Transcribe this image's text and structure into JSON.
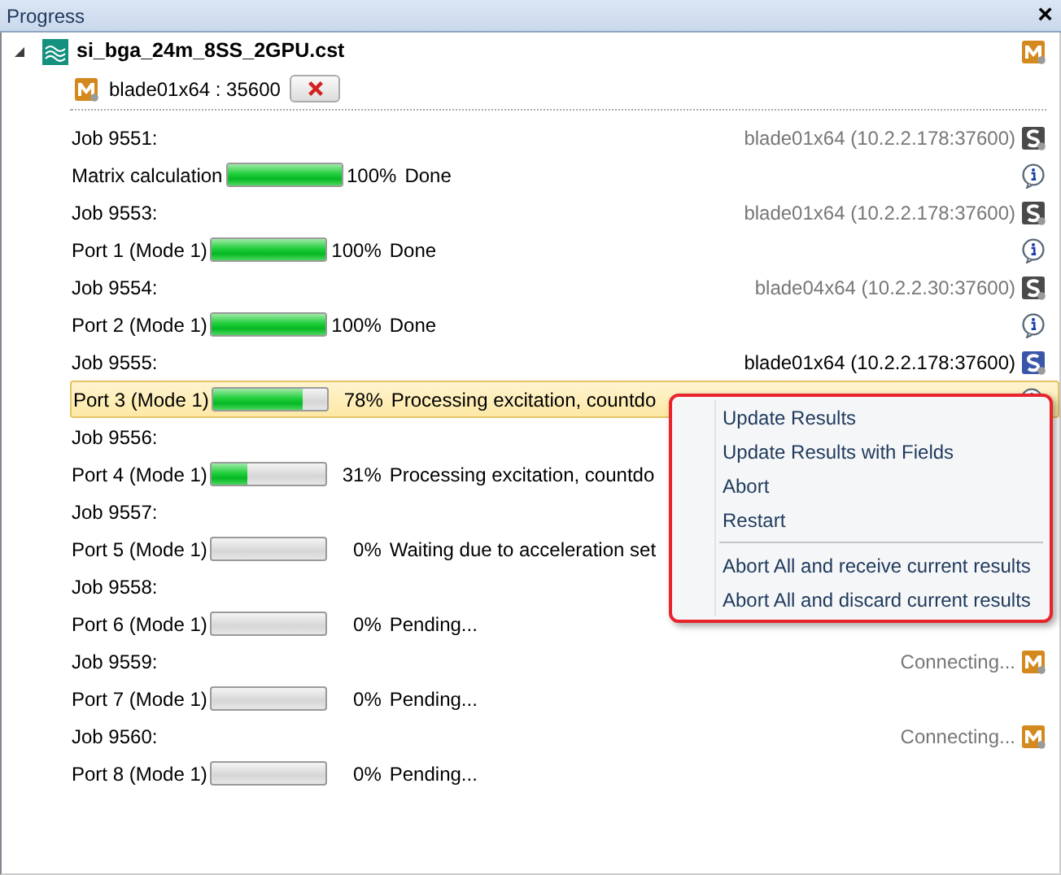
{
  "panel": {
    "title": "Progress",
    "close": "×"
  },
  "project": {
    "name": "si_bga_24m_8SS_2GPU.cst",
    "expanded": true
  },
  "server": {
    "label": "blade01x64 : 35600"
  },
  "jobs": [
    {
      "label": "Job 9551:",
      "host": "blade01x64 (10.2.2.178:37600)",
      "kind": "solver",
      "active": false,
      "task": {
        "label": "Matrix calculation",
        "level": 1,
        "percent": "100%",
        "status": "Done",
        "info": true,
        "selected": false
      }
    },
    {
      "label": "Job 9553:",
      "host": "blade01x64 (10.2.2.178:37600)",
      "kind": "solver",
      "active": false,
      "task": {
        "label": "Port 1 (Mode 1)",
        "level": 1,
        "percent": "100%",
        "status": "Done",
        "info": true,
        "selected": false
      }
    },
    {
      "label": "Job 9554:",
      "host": "blade04x64 (10.2.2.30:37600)",
      "kind": "solver",
      "active": false,
      "task": {
        "label": "Port 2 (Mode 1)",
        "level": 1,
        "percent": "100%",
        "status": "Done",
        "info": true,
        "selected": false
      }
    },
    {
      "label": "Job 9555:",
      "host": "blade01x64 (10.2.2.178:37600)",
      "kind": "solver",
      "active": true,
      "task": {
        "label": "Port 3 (Mode 1)",
        "level": 0.78,
        "percent": "78%",
        "status": "Processing excitation, countdo",
        "info": true,
        "selected": true
      }
    },
    {
      "label": "Job 9556:",
      "task": {
        "label": "Port 4 (Mode 1)",
        "level": 0.31,
        "percent": "31%",
        "status": "Processing excitation, countdo",
        "info": false,
        "selected": false
      }
    },
    {
      "label": "Job 9557:",
      "task": {
        "label": "Port 5 (Mode 1)",
        "level": 0,
        "percent": "0%",
        "status": "Waiting due to acceleration set",
        "info": false,
        "selected": false
      }
    },
    {
      "label": "Job 9558:",
      "task": {
        "label": "Port 6 (Mode 1)",
        "level": 0,
        "percent": "0%",
        "status": "Pending...",
        "info": false,
        "selected": false
      }
    },
    {
      "label": "Job 9559:",
      "host": "Connecting...",
      "kind": "main",
      "active": false,
      "task": {
        "label": "Port 7 (Mode 1)",
        "level": 0,
        "percent": "0%",
        "status": "Pending...",
        "info": false,
        "selected": false
      }
    },
    {
      "label": "Job 9560:",
      "host": "Connecting...",
      "kind": "main",
      "active": false,
      "task": {
        "label": "Port 8 (Mode 1)",
        "level": 0,
        "percent": "0%",
        "status": "Pending...",
        "info": false,
        "selected": false
      }
    }
  ],
  "context_menu": {
    "groups": [
      [
        "Update Results",
        "Update Results with Fields",
        "Abort",
        "Restart"
      ],
      [
        "Abort All and receive current results",
        "Abort All and discard current results"
      ]
    ]
  }
}
